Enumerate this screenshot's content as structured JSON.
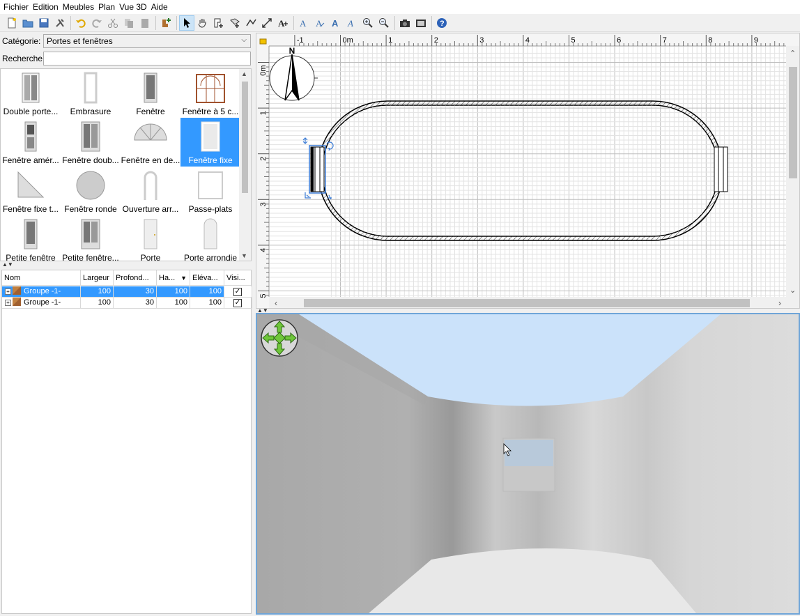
{
  "menu": [
    "Fichier",
    "Edition",
    "Meubles",
    "Plan",
    "Vue 3D",
    "Aide"
  ],
  "toolbar": {
    "icons": [
      "new-document-icon",
      "open-icon",
      "save-icon",
      "preferences-icon",
      "undo-icon",
      "redo-icon",
      "cut-icon",
      "copy-icon",
      "paste-icon",
      "add-furniture-icon",
      "select-arrow-icon",
      "pan-hand-icon",
      "create-walls-icon",
      "create-rooms-icon",
      "create-polylines-icon",
      "create-dimensions-icon",
      "add-text-icon",
      "text-style-icon",
      "text-increase-icon",
      "text-bold-icon",
      "text-italic-icon",
      "zoom-in-icon",
      "zoom-out-icon",
      "camera-photo-icon",
      "video-icon",
      "help-icon"
    ]
  },
  "catalog": {
    "category_label": "Catégorie:",
    "category_value": "Portes et fenêtres",
    "search_label": "Recherche:",
    "search_value": "",
    "items": [
      "Double porte...",
      "Embrasure",
      "Fenêtre",
      "Fenêtre à 5 c...",
      "Fenêtre amér...",
      "Fenêtre doub...",
      "Fenêtre en de...",
      "Fenêtre fixe",
      "Fenêtre fixe t...",
      "Fenêtre ronde",
      "Ouverture arr...",
      "Passe-plats",
      "Petite fenêtre",
      "Petite fenêtre...",
      "Porte",
      "Porte arrondie"
    ],
    "selected_index": 7
  },
  "furniture_table": {
    "headers": [
      "Nom",
      "Largeur",
      "Profond...",
      "Ha...",
      "Eléva...",
      "Visi..."
    ],
    "rows": [
      {
        "name": "Groupe -1-",
        "width": "100",
        "depth": "30",
        "height": "100",
        "elevation": "100",
        "visible": true
      },
      {
        "name": "Groupe -1-",
        "width": "100",
        "depth": "30",
        "height": "100",
        "elevation": "100",
        "visible": true
      }
    ]
  },
  "plan": {
    "ruler_x": [
      "-1",
      "0m",
      "1",
      "2",
      "3",
      "4",
      "5",
      "6",
      "7",
      "8",
      "9"
    ],
    "ruler_y": [
      "0m",
      "1",
      "2",
      "3",
      "4",
      "5"
    ],
    "compass_label": "N"
  }
}
